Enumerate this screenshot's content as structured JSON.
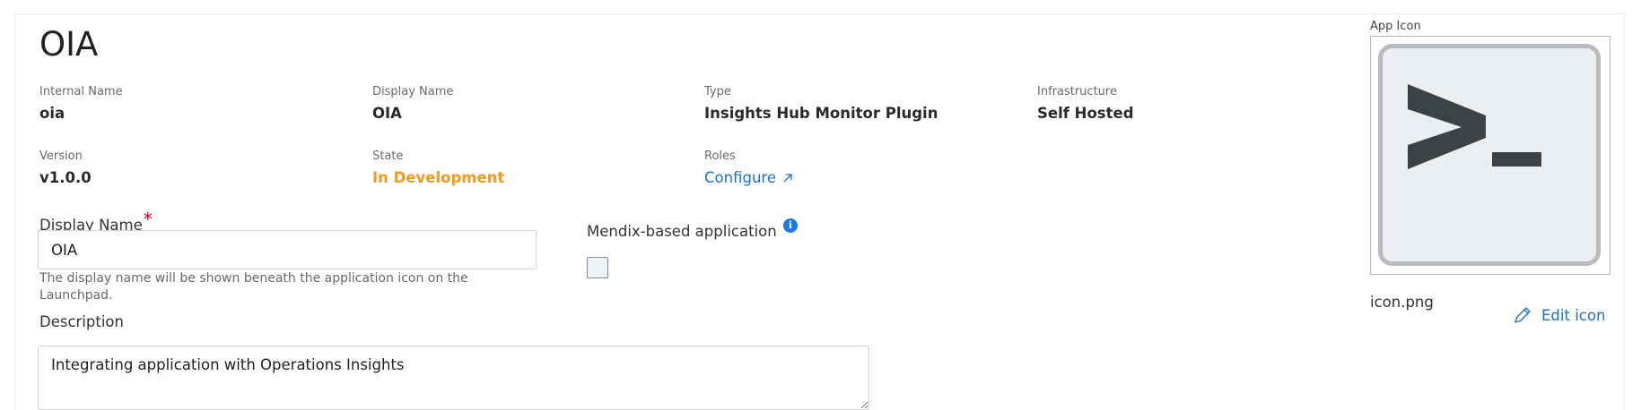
{
  "app": {
    "title": "OIA"
  },
  "details": {
    "internal_name": {
      "label": "Internal Name",
      "value": "oia"
    },
    "display_name": {
      "label": "Display Name",
      "value": "OIA"
    },
    "type": {
      "label": "Type",
      "value": "Insights Hub Monitor Plugin"
    },
    "infrastructure": {
      "label": "Infrastructure",
      "value": "Self Hosted"
    },
    "version": {
      "label": "Version",
      "value": "v1.0.0"
    },
    "state": {
      "label": "State",
      "value": "In Development",
      "color": "#f39a1e"
    },
    "roles": {
      "label": "Roles",
      "link_label": "Configure"
    }
  },
  "form": {
    "display_name": {
      "label": "Display Name",
      "required_mark": "*",
      "value": "OIA",
      "helper": "The display name will be shown beneath the application icon on the Launchpad."
    },
    "description": {
      "label": "Description",
      "value": "Integrating application with Operations Insights"
    },
    "mendix": {
      "label": "Mendix-based application",
      "checked": false,
      "info_icon": "info-icon"
    }
  },
  "icon_panel": {
    "label": "App Icon",
    "filename": "icon.png",
    "edit_label": "Edit icon",
    "image_icon": "terminal-prompt-icon"
  },
  "colors": {
    "link": "#1b6fd1",
    "state": "#f39a1e",
    "required": "#d0021b",
    "info": "#1b7ae0"
  }
}
